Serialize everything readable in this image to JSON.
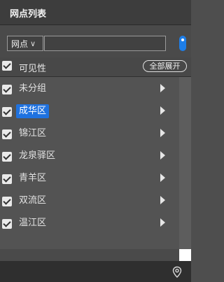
{
  "panel": {
    "title": "网点列表"
  },
  "search": {
    "type_label": "网点",
    "type_chevron": "∨",
    "value": "",
    "placeholder": ""
  },
  "visibility": {
    "label": "可见性",
    "expand_all_label": "全部展开"
  },
  "districts": [
    {
      "name": "未分组",
      "checked": true,
      "selected": false
    },
    {
      "name": "成华区",
      "checked": true,
      "selected": true
    },
    {
      "name": "锦江区",
      "checked": true,
      "selected": false
    },
    {
      "name": "龙泉驿区",
      "checked": true,
      "selected": false
    },
    {
      "name": "青羊区",
      "checked": true,
      "selected": false
    },
    {
      "name": "双流区",
      "checked": true,
      "selected": false
    },
    {
      "name": "温江区",
      "checked": true,
      "selected": false
    }
  ],
  "colors": {
    "accent": "#1f72e0",
    "background": "#4e4e4e",
    "header": "#3d3d3d",
    "footer": "#2f2f2f"
  },
  "icons": {
    "locate": "location-toggle-icon",
    "footer": "map-pin-icon",
    "row": "caret-right-icon",
    "check": "checkbox-checked-icon"
  }
}
